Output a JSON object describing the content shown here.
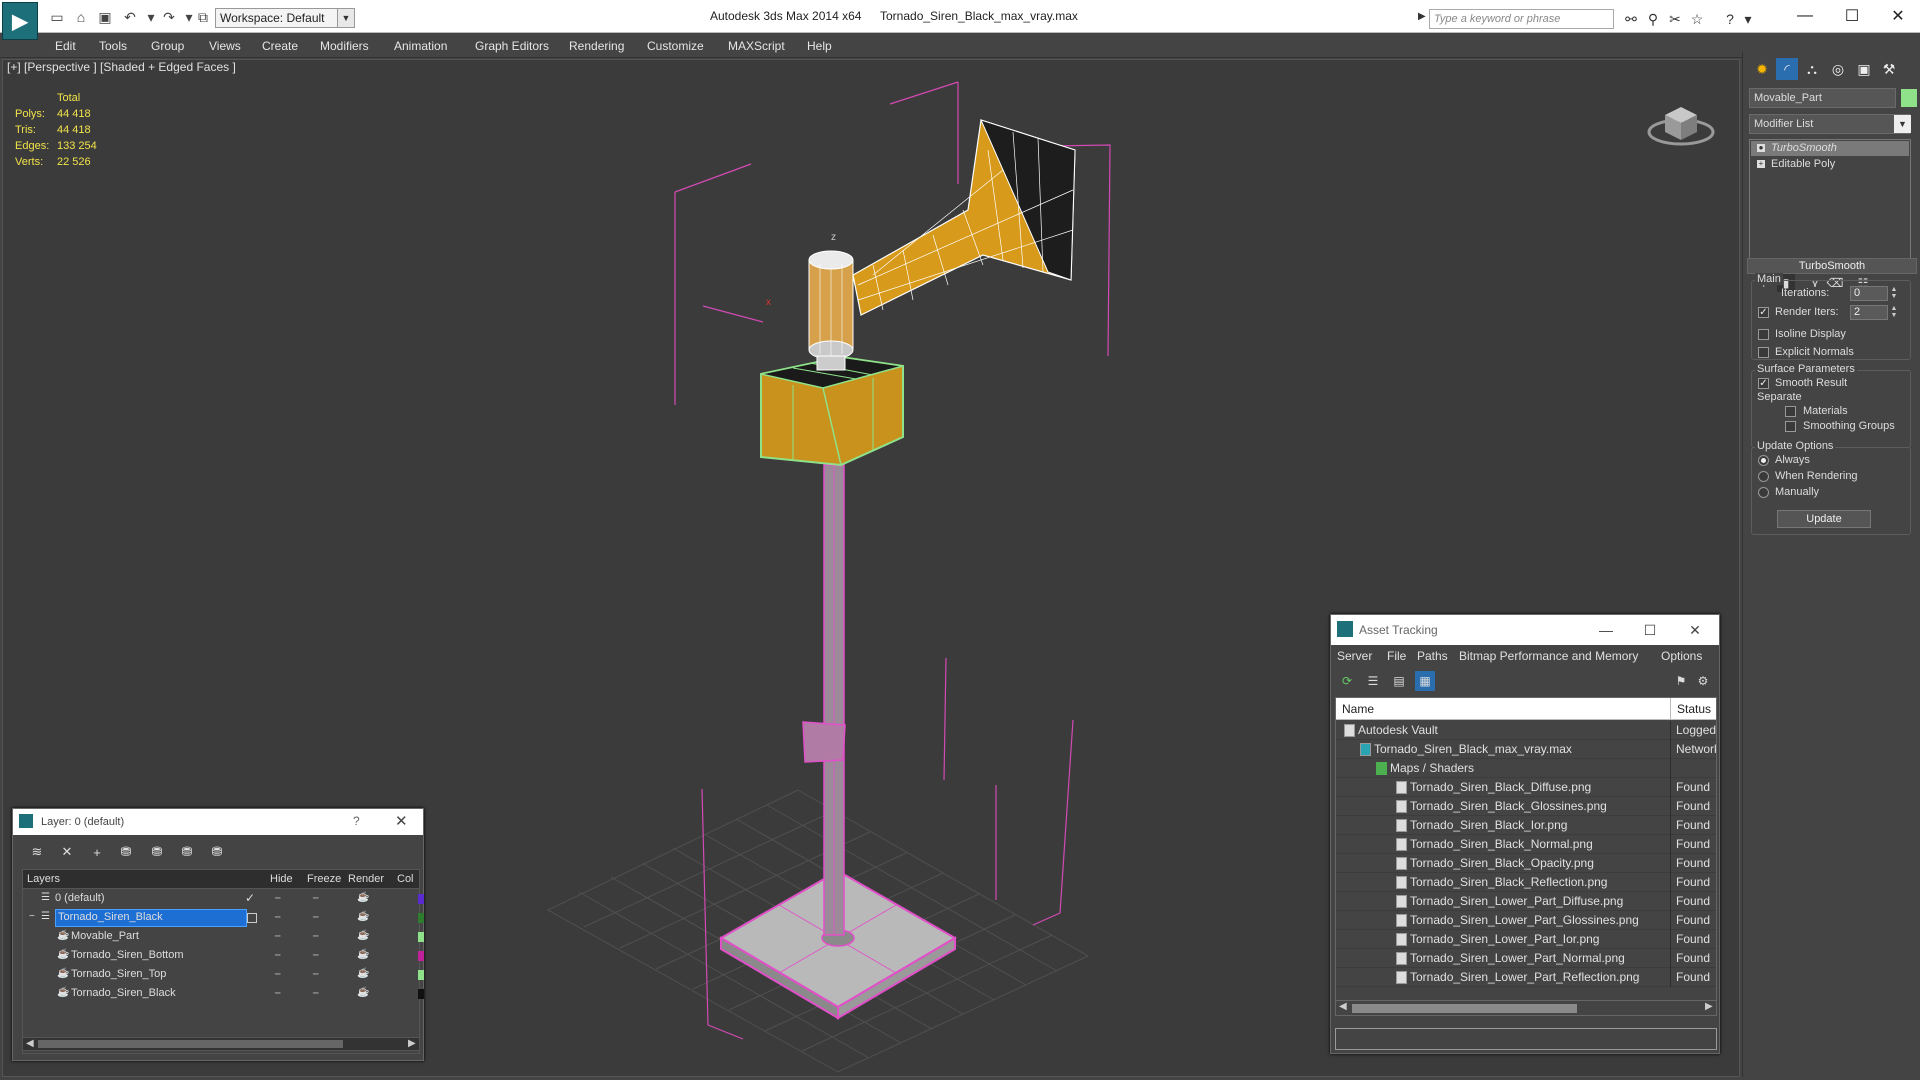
{
  "titlebar": {
    "app_title": "Autodesk 3ds Max  2014 x64",
    "file_title": "Tornado_Siren_Black_max_vray.max",
    "workspace": "Workspace: Default",
    "search_placeholder": "Type a keyword or phrase"
  },
  "menu": [
    "Edit",
    "Tools",
    "Group",
    "Views",
    "Create",
    "Modifiers",
    "Animation",
    "Graph Editors",
    "Rendering",
    "Customize",
    "MAXScript",
    "Help"
  ],
  "viewport": {
    "label": "[+] [Perspective ] [Shaded + Edged Faces ]",
    "stats": {
      "header": "Total",
      "rows": [
        {
          "key": "Polys:",
          "value": "44 418"
        },
        {
          "key": "Tris:",
          "value": "44 418"
        },
        {
          "key": "Edges:",
          "value": "133 254"
        },
        {
          "key": "Verts:",
          "value": "22 526"
        }
      ]
    }
  },
  "command_panel": {
    "object_name": "Movable_Part",
    "modifier_list": "Modifier List",
    "stack": [
      "TurboSmooth",
      "Editable Poly"
    ],
    "turbosmooth": {
      "title": "TurboSmooth",
      "main_label": "Main",
      "iterations_label": "Iterations:",
      "iterations_value": "0",
      "render_iters_label": "Render Iters:",
      "render_iters_value": "2",
      "isoline_label": "Isoline Display",
      "explicit_normals_label": "Explicit Normals",
      "surface_params_label": "Surface Parameters",
      "smooth_result_label": "Smooth Result",
      "separate_label": "Separate",
      "materials_label": "Materials",
      "smoothing_groups_label": "Smoothing Groups",
      "update_options_label": "Update Options",
      "always_label": "Always",
      "when_rendering_label": "When Rendering",
      "manually_label": "Manually",
      "update_button": "Update"
    }
  },
  "layer_dialog": {
    "title": "Layer: 0 (default)",
    "help": "?",
    "columns": [
      "Layers",
      "Hide",
      "Freeze",
      "Render",
      "Col"
    ],
    "rows": [
      {
        "name": "0 (default)",
        "color": "#5a2bd0"
      },
      {
        "name": "Tornado_Siren_Black",
        "color": "#2e7d2e"
      },
      {
        "name": "Movable_Part",
        "color": "#8fe28a"
      },
      {
        "name": "Tornado_Siren_Bottom",
        "color": "#c0209a"
      },
      {
        "name": "Tornado_Siren_Top",
        "color": "#8fe28a"
      },
      {
        "name": "Tornado_Siren_Black",
        "color": "#111111"
      }
    ]
  },
  "asset_tracking": {
    "title": "Asset Tracking",
    "menu": [
      "Server",
      "File",
      "Paths",
      "Bitmap Performance and Memory",
      "Options"
    ],
    "columns": [
      "Name",
      "Status"
    ],
    "rows": [
      {
        "name": "Autodesk Vault",
        "status": "Logged"
      },
      {
        "name": "Tornado_Siren_Black_max_vray.max",
        "status": "Network"
      },
      {
        "name": "Maps / Shaders",
        "status": ""
      },
      {
        "name": "Tornado_Siren_Black_Diffuse.png",
        "status": "Found"
      },
      {
        "name": "Tornado_Siren_Black_Glossines.png",
        "status": "Found"
      },
      {
        "name": "Tornado_Siren_Black_Ior.png",
        "status": "Found"
      },
      {
        "name": "Tornado_Siren_Black_Normal.png",
        "status": "Found"
      },
      {
        "name": "Tornado_Siren_Black_Opacity.png",
        "status": "Found"
      },
      {
        "name": "Tornado_Siren_Black_Reflection.png",
        "status": "Found"
      },
      {
        "name": "Tornado_Siren_Lower_Part_Diffuse.png",
        "status": "Found"
      },
      {
        "name": "Tornado_Siren_Lower_Part_Glossines.png",
        "status": "Found"
      },
      {
        "name": "Tornado_Siren_Lower_Part_Ior.png",
        "status": "Found"
      },
      {
        "name": "Tornado_Siren_Lower_Part_Normal.png",
        "status": "Found"
      },
      {
        "name": "Tornado_Siren_Lower_Part_Reflection.png",
        "status": "Found"
      }
    ]
  },
  "colors": {
    "accent": "#1d6f7a",
    "selection": "#1e6fd4",
    "wire_pink": "#e14fc9",
    "wire_green": "#8fe28a",
    "mesh_orange": "#d89a1a",
    "stats_yellow": "#f2e34a"
  }
}
